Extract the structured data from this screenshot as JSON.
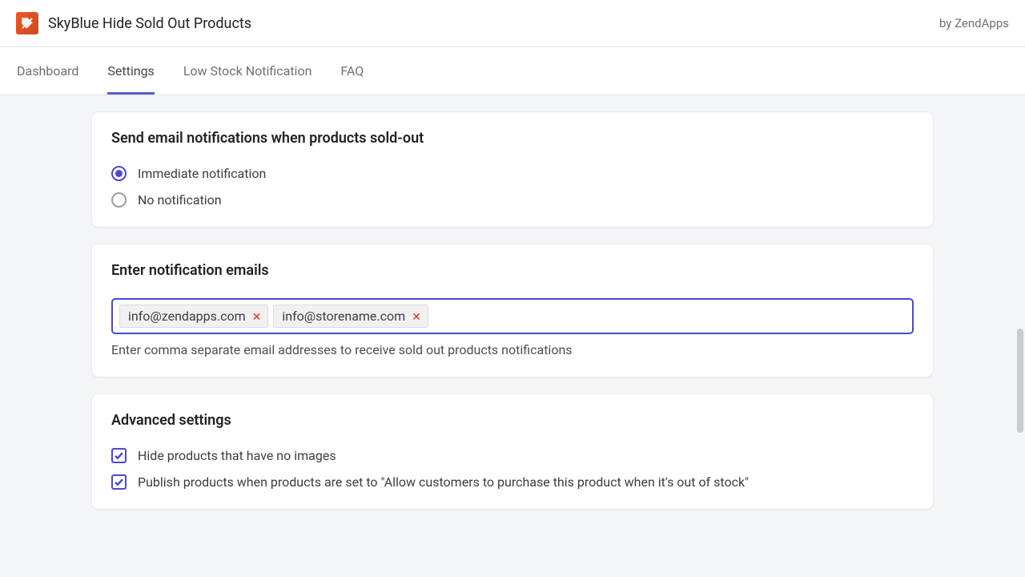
{
  "header": {
    "app_title": "SkyBlue Hide Sold Out Products",
    "by_text": "by ZendApps"
  },
  "tabs": [
    {
      "label": "Dashboard",
      "active": false
    },
    {
      "label": "Settings",
      "active": true
    },
    {
      "label": "Low Stock Notification",
      "active": false
    },
    {
      "label": "FAQ",
      "active": false
    }
  ],
  "section_notify": {
    "title": "Send email notifications when products sold-out",
    "options": {
      "immediate": "Immediate notification",
      "none": "No notification"
    },
    "selected": "immediate"
  },
  "section_emails": {
    "title": "Enter notification emails",
    "chips": [
      "info@zendapps.com",
      "info@storename.com"
    ],
    "helper": "Enter comma separate email addresses to receive sold out products notifications"
  },
  "section_advanced": {
    "title": "Advanced settings",
    "opt_hide_no_images": {
      "label": "Hide products that have no images",
      "checked": true
    },
    "opt_publish_oos": {
      "label": "Publish products when products are set to \"Allow customers to purchase this product when it's out of stock\"",
      "checked": true
    }
  }
}
